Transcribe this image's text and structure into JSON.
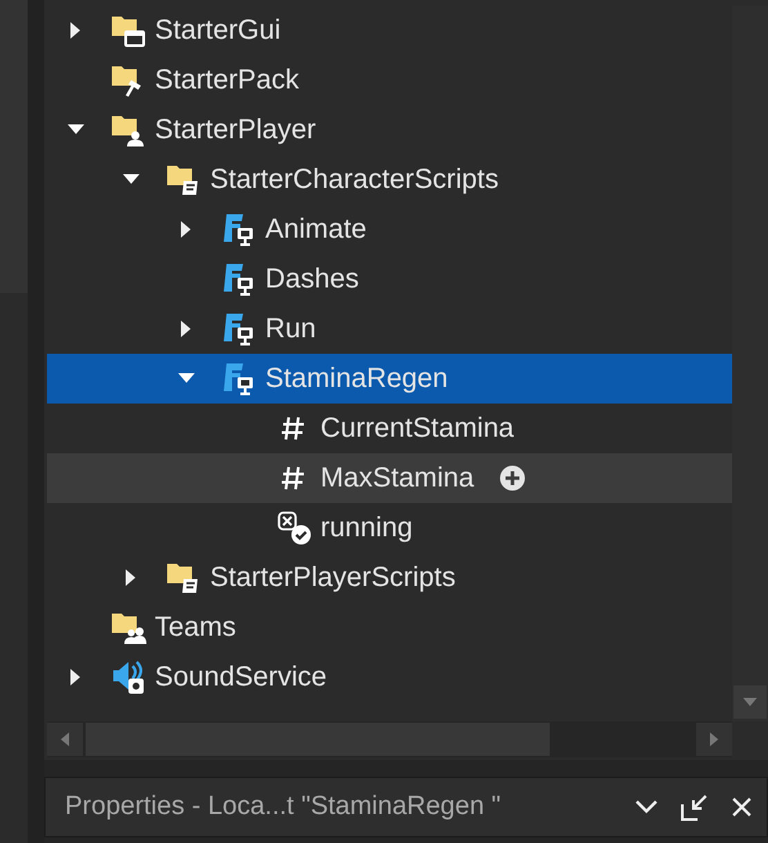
{
  "explorer": {
    "tree": [
      {
        "label": "StarterGui",
        "kind": "folder-gui",
        "expanded": false,
        "selected": false
      },
      {
        "label": "StarterPack",
        "kind": "folder-tool",
        "selected": false
      },
      {
        "label": "StarterPlayer",
        "kind": "folder-player",
        "expanded": true,
        "selected": false,
        "children": [
          {
            "label": "StarterCharacterScripts",
            "kind": "folder-script",
            "expanded": true,
            "selected": false,
            "children": [
              {
                "label": "Animate",
                "kind": "local-script",
                "expanded": false,
                "selected": false
              },
              {
                "label": "Dashes",
                "kind": "local-script",
                "selected": false
              },
              {
                "label": "Run",
                "kind": "local-script",
                "expanded": false,
                "selected": false
              },
              {
                "label": "StaminaRegen",
                "kind": "local-script",
                "expanded": true,
                "selected": true,
                "children": [
                  {
                    "label": "CurrentStamina",
                    "kind": "number",
                    "selected": false
                  },
                  {
                    "label": "MaxStamina",
                    "kind": "number",
                    "selected": false,
                    "hovered": true
                  },
                  {
                    "label": "running",
                    "kind": "bool",
                    "selected": false
                  }
                ]
              }
            ]
          },
          {
            "label": "StarterPlayerScripts",
            "kind": "folder-script",
            "expanded": false,
            "selected": false
          }
        ]
      },
      {
        "label": "Teams",
        "kind": "folder-teams",
        "selected": false
      },
      {
        "label": "SoundService",
        "kind": "sound",
        "expanded": false,
        "selected": false
      }
    ]
  },
  "properties": {
    "title": "Properties - Loca...t \"StaminaRegen \""
  }
}
